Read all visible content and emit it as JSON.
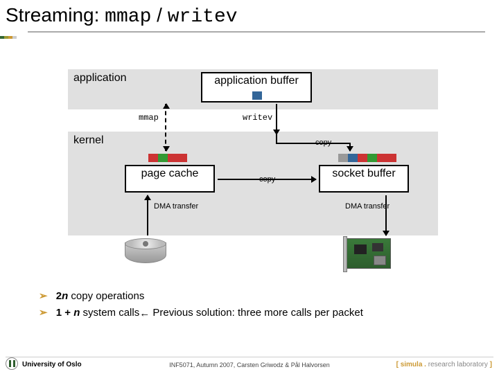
{
  "title": {
    "plain": "Streaming: ",
    "code1": "mmap",
    "slash": " / ",
    "code2": "writev"
  },
  "application": {
    "label": "application"
  },
  "kernel": {
    "label": "kernel"
  },
  "app_buffer": {
    "label": "application buffer"
  },
  "page_cache": {
    "label": "page cache"
  },
  "socket_buffer": {
    "label": "socket buffer"
  },
  "arrows": {
    "mmap": "mmap",
    "writev": "writev",
    "copy": "copy",
    "dma": "DMA transfer"
  },
  "bullets": {
    "b1_prefix": "2",
    "b1_n": "n",
    "b1_suffix": " copy operations",
    "b2_prefix": "1 + ",
    "b2_n": "n",
    "b2_mid": " system calls",
    "b2_arrow": "←",
    "b2_suffix": " Previous solution: three more calls per packet"
  },
  "footer": {
    "left": "University of Oslo",
    "center": "INF5071, Autumn 2007, Carsten Griwodz & Pål Halvorsen",
    "right_bracket_l": "[ ",
    "right_sim": "simula",
    "right_dot": " . ",
    "right_lab": "research laboratory",
    "right_bracket_r": " ]"
  }
}
